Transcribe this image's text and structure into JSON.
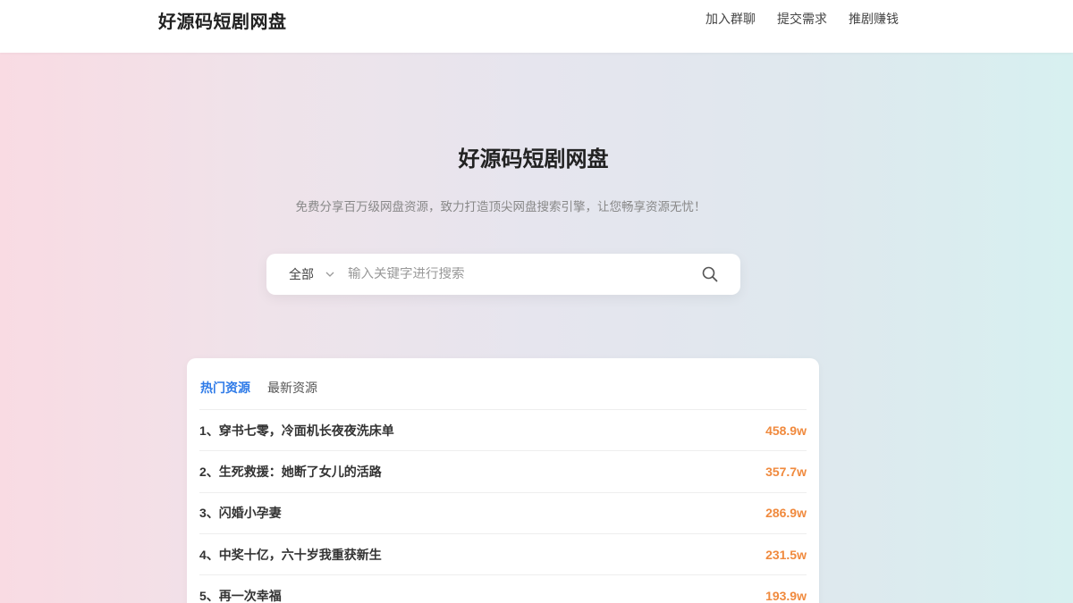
{
  "header": {
    "logo": "好源码短剧网盘",
    "nav": [
      "加入群聊",
      "提交需求",
      "推剧赚钱"
    ]
  },
  "hero": {
    "title": "好源码短剧网盘",
    "subtitle": "免费分享百万级网盘资源，致力打造顶尖网盘搜索引擎，让您畅享资源无忧！"
  },
  "search": {
    "category": "全部",
    "placeholder": "输入关键字进行搜索",
    "category_icon": "chevron-down-icon",
    "submit_icon": "search-icon"
  },
  "tabs": [
    {
      "label": "热门资源",
      "active": true
    },
    {
      "label": "最新资源",
      "active": false
    }
  ],
  "items": [
    {
      "title": "1、穿书七零，冷面机长夜夜洗床单",
      "count": "458.9w"
    },
    {
      "title": "2、生死救援：她断了女儿的活路",
      "count": "357.7w"
    },
    {
      "title": "3、闪婚小孕妻",
      "count": "286.9w"
    },
    {
      "title": "4、中奖十亿，六十岁我重获新生",
      "count": "231.5w"
    },
    {
      "title": "5、再一次幸福",
      "count": "193.9w"
    }
  ],
  "colors": {
    "accent": "#2f7be8",
    "count": "#f08a3e"
  }
}
